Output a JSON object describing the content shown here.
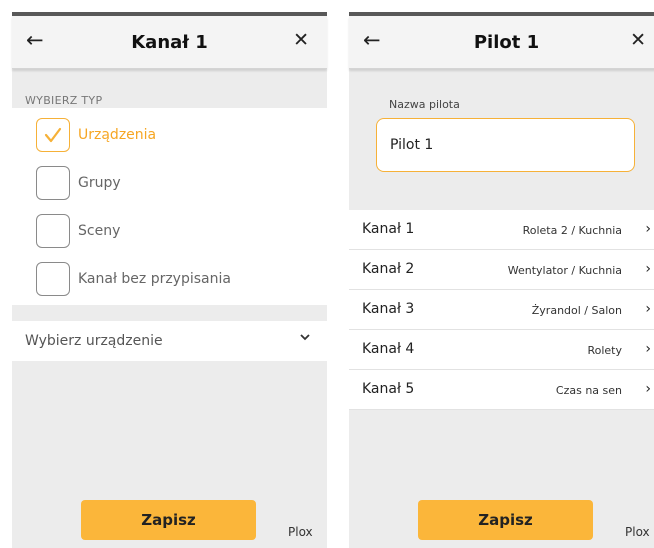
{
  "left_screen": {
    "title": "Kanał 1",
    "back_icon": "←",
    "close_icon": "✕",
    "section_label": "WYBIERZ TYP",
    "options": [
      {
        "label": "Urządzenia",
        "checked": true
      },
      {
        "label": "Grupy",
        "checked": false
      },
      {
        "label": "Sceny",
        "checked": false
      },
      {
        "label": "Kanał bez przypisania",
        "checked": false
      }
    ],
    "dropdown": {
      "label": "Wybierz urządzenie",
      "chevron": "⌄"
    },
    "save_label": "Zapisz",
    "brand": "Plox"
  },
  "right_screen": {
    "title": "Pilot 1",
    "back_icon": "←",
    "close_icon": "✕",
    "name_label": "Nazwa pilota",
    "name_value": "Pilot 1",
    "channels": [
      {
        "name": "Kanał 1",
        "value": "Roleta 2 / Kuchnia"
      },
      {
        "name": "Kanał 2",
        "value": "Wentylator / Kuchnia"
      },
      {
        "name": "Kanał 3",
        "value": "Żyrandol / Salon"
      },
      {
        "name": "Kanał 4",
        "value": "Rolety"
      },
      {
        "name": "Kanał 5",
        "value": "Czas na sen"
      }
    ],
    "chevron": "›",
    "save_label": "Zapisz",
    "brand": "Plox"
  },
  "colors": {
    "accent": "#fbb63a",
    "accent_text": "#f6a623",
    "background": "#ececec",
    "status_bar": "#585858"
  }
}
